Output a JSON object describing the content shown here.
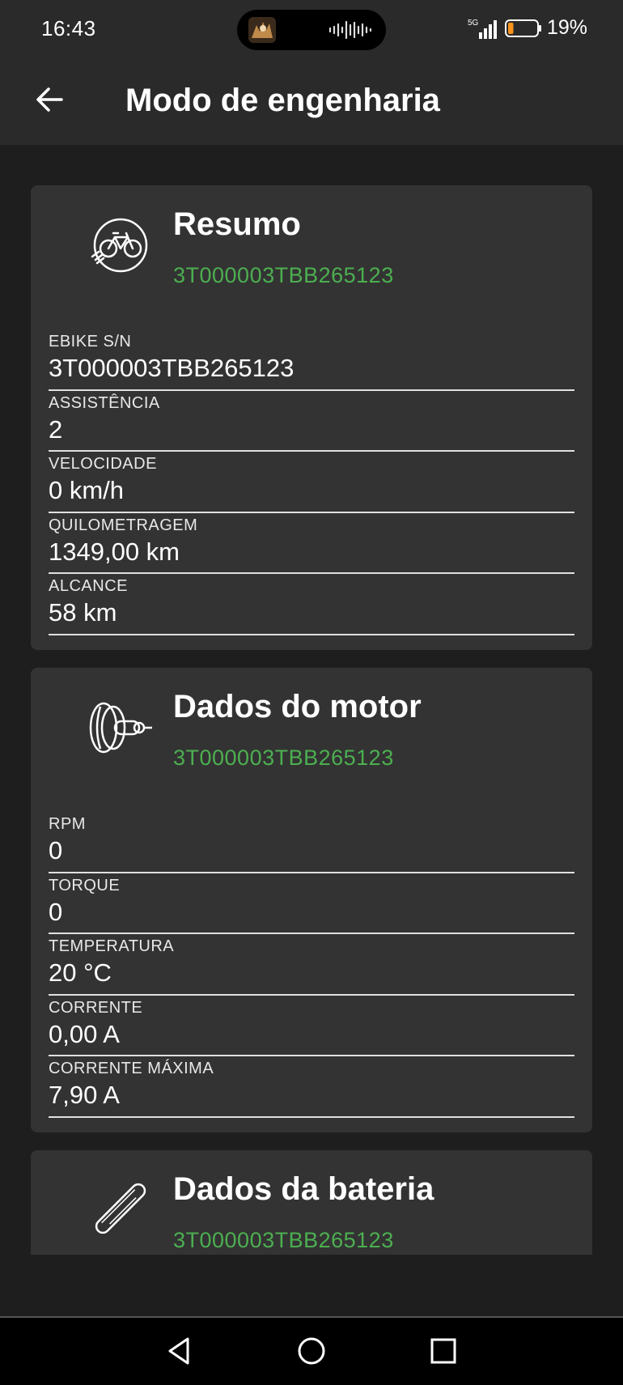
{
  "status_bar": {
    "time": "16:43",
    "network": "5G",
    "battery_percent": "19%",
    "battery_level": 0.19,
    "battery_color": "#f7941d",
    "icons": [
      "island-artwork-icon",
      "audio-wave-icon",
      "signal-icon",
      "battery-icon"
    ]
  },
  "app_bar": {
    "back_icon": "arrow-left-icon",
    "title": "Modo de engenharia"
  },
  "cards": {
    "summary": {
      "icon": "ebike-icon",
      "title": "Resumo",
      "serial": "3T000003TBB265123",
      "fields": [
        {
          "label": "EBIKE S/N",
          "value": "3T000003TBB265123"
        },
        {
          "label": "ASSISTÊNCIA",
          "value": "2"
        },
        {
          "label": "VELOCIDADE",
          "value": "0 km/h"
        },
        {
          "label": "QUILOMETRAGEM",
          "value": "1349,00 km"
        },
        {
          "label": "ALCANCE",
          "value": "58 km"
        }
      ]
    },
    "motor": {
      "icon": "motor-icon",
      "title": "Dados do motor",
      "serial": "3T000003TBB265123",
      "fields": [
        {
          "label": "RPM",
          "value": "0"
        },
        {
          "label": "TORQUE",
          "value": "0"
        },
        {
          "label": "TEMPERATURA",
          "value": "20 °C"
        },
        {
          "label": "CORRENTE",
          "value": "0,00 A"
        },
        {
          "label": "CORRENTE MÁXIMA",
          "value": "7,90 A"
        }
      ]
    },
    "battery": {
      "icon": "battery-pack-icon",
      "title": "Dados da bateria",
      "serial": "3T000003TBB265123"
    }
  },
  "nav_bar": {
    "icons": [
      "nav-back-icon",
      "nav-home-icon",
      "nav-recents-icon"
    ]
  },
  "colors": {
    "accent_green": "#4caf50",
    "card_bg": "#333333",
    "page_bg": "#1e1e1e"
  }
}
